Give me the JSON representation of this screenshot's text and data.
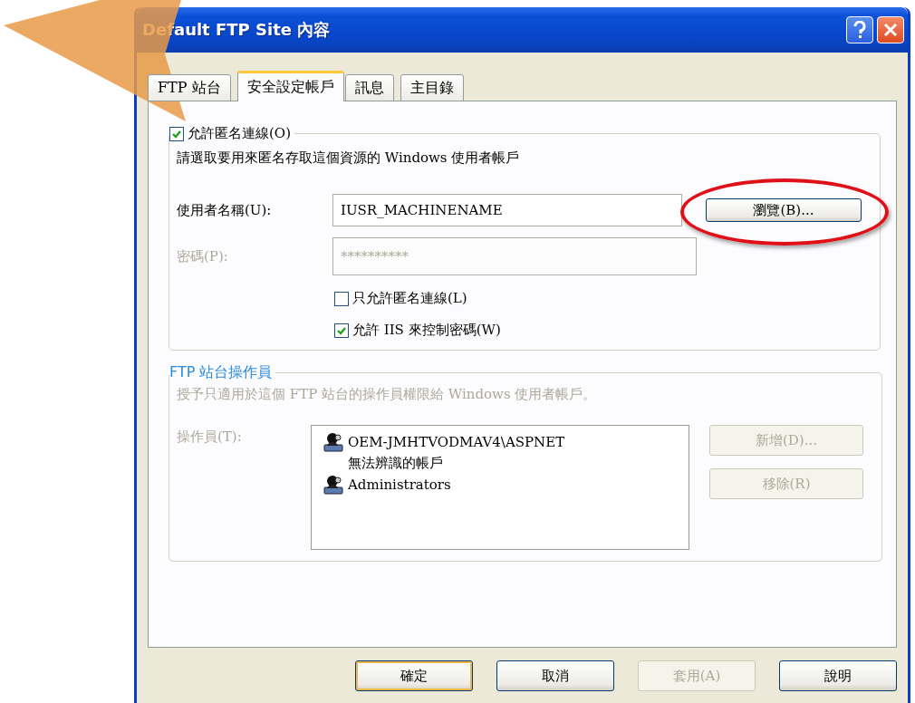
{
  "window": {
    "title": "Default FTP Site 內容"
  },
  "tabs": [
    {
      "label": "FTP 站台",
      "selected": false
    },
    {
      "label": "安全設定帳戶",
      "selected": true
    },
    {
      "label": "訊息",
      "selected": false
    },
    {
      "label": "主目錄",
      "selected": false
    }
  ],
  "anonymous": {
    "checkbox": {
      "label": "允許匿名連線(O)",
      "checked": true
    },
    "description": "請選取要用來匿名存取這個資源的 Windows 使用者帳戶",
    "username": {
      "label": "使用者名稱(U):",
      "value": "IUSR_MACHINENAME"
    },
    "browse_button": {
      "label": "瀏覽(B)...",
      "highlighted": true
    },
    "password": {
      "label": "密碼(P):",
      "value": "**********",
      "disabled": true
    },
    "options": [
      {
        "label": "只允許匿名連線(L)",
        "checked": false
      },
      {
        "label": "允許 IIS 來控制密碼(W)",
        "checked": true
      }
    ]
  },
  "operators": {
    "title": "FTP 站台操作員",
    "disabled": true,
    "description": "授予只適用於這個 FTP 站台的操作員權限給 Windows 使用者帳戶。",
    "label": "操作員(T):",
    "items": [
      {
        "kind": "group",
        "name": "OEM-JMHTVODMAV4\\ASPNET"
      },
      {
        "kind": "unknown",
        "name": "無法辨識的帳戶"
      },
      {
        "kind": "group",
        "name": "Administrators"
      }
    ],
    "buttons": [
      {
        "label": "新增(D)...",
        "disabled": true
      },
      {
        "label": "移除(R)",
        "disabled": true
      }
    ]
  },
  "buttons": [
    {
      "label": "確定",
      "default": true,
      "disabled": false
    },
    {
      "label": "取消",
      "default": false,
      "disabled": false
    },
    {
      "label": "套用(A)",
      "default": false,
      "disabled": true
    },
    {
      "label": "說明",
      "default": false,
      "disabled": false
    }
  ]
}
